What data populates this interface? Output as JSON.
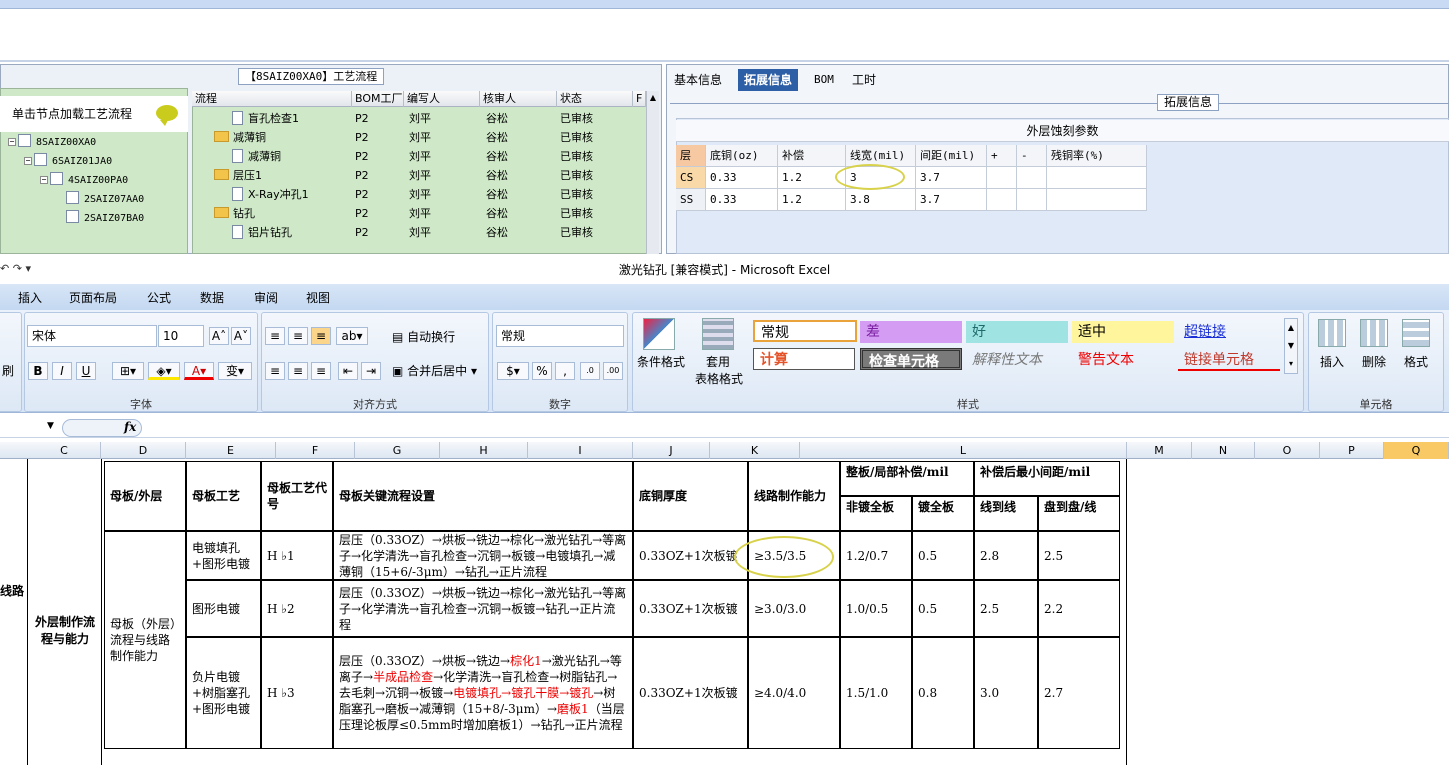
{
  "left_panel": {
    "title": "【8SAIZ00XA0】工艺流程",
    "tree_hint": "单击节点加载工艺流程",
    "tree": [
      {
        "label": "8SAIZ00XA0"
      },
      {
        "label": "6SAIZ01JA0"
      },
      {
        "label": "4SAIZ00PA0"
      },
      {
        "label": "2SAIZ07AA0"
      },
      {
        "label": "2SAIZ07BA0"
      }
    ],
    "grid_headers": [
      "流程",
      "BOM工厂",
      "编写人",
      "核审人",
      "状态",
      "F"
    ],
    "grid_rows": [
      {
        "flow": "盲孔检查1",
        "bom": "P2",
        "author": "刘平",
        "reviewer": "谷松",
        "status": "已审核",
        "folder": false
      },
      {
        "flow": "减薄铜",
        "bom": "P2",
        "author": "刘平",
        "reviewer": "谷松",
        "status": "已审核",
        "folder": true
      },
      {
        "flow": "减薄铜",
        "bom": "P2",
        "author": "刘平",
        "reviewer": "谷松",
        "status": "已审核",
        "folder": false
      },
      {
        "flow": "层压1",
        "bom": "P2",
        "author": "刘平",
        "reviewer": "谷松",
        "status": "已审核",
        "folder": true
      },
      {
        "flow": "X-Ray冲孔1",
        "bom": "P2",
        "author": "刘平",
        "reviewer": "谷松",
        "status": "已审核",
        "folder": false
      },
      {
        "flow": "钻孔",
        "bom": "P2",
        "author": "刘平",
        "reviewer": "谷松",
        "status": "已审核",
        "folder": true
      },
      {
        "flow": "铝片钻孔",
        "bom": "P2",
        "author": "刘平",
        "reviewer": "谷松",
        "status": "已审核",
        "folder": false
      }
    ]
  },
  "right_panel": {
    "tabs": [
      "基本信息",
      "拓展信息",
      "BOM",
      "工时"
    ],
    "legend": "拓展信息",
    "etch_title": "外层蚀刻参数",
    "etch_headers": [
      "层",
      "底铜(oz)",
      "补偿",
      "线宽(mil)",
      "间距(mil)",
      "+",
      "-",
      "残铜率(%)"
    ],
    "etch_rows": [
      [
        "CS",
        "0.33",
        "1.2",
        "3",
        "3.7",
        "",
        "",
        ""
      ],
      [
        "SS",
        "0.33",
        "1.2",
        "3.8",
        "3.7",
        "",
        "",
        ""
      ]
    ]
  },
  "excel": {
    "title": "激光钻孔  [兼容模式] - Microsoft Excel",
    "menus": [
      "插入",
      "页面布局",
      "公式",
      "数据",
      "审阅",
      "视图"
    ],
    "font_name": "宋体",
    "font_size": "10",
    "number_format": "常规",
    "wrap_text": "自动换行",
    "merge_center": "合并后居中",
    "cond_format": "条件格式",
    "table_format_1": "套用",
    "table_format_2": "表格格式",
    "styles": [
      "常规",
      "差",
      "好",
      "适中",
      "超链接",
      "计算",
      "检查单元格",
      "解释性文本",
      "警告文本",
      "链接单元格"
    ],
    "cells_buttons": [
      "插入",
      "删除",
      "格式"
    ],
    "group_labels": [
      "字体",
      "对齐方式",
      "数字",
      "样式",
      "单元格"
    ],
    "left_cut_label": "刷",
    "fx": "fx",
    "columns": [
      "C",
      "D",
      "E",
      "F",
      "G",
      "H",
      "I",
      "J",
      "K",
      "L",
      "M",
      "N",
      "O",
      "P",
      "Q"
    ]
  },
  "sheet": {
    "left_cut": "线路",
    "side_label": "外层制作流程与能力",
    "headers": {
      "mother_outer": "母板/外层",
      "mother_process": "母板工艺",
      "process_code": "母板工艺代号",
      "key_flow": "母板关键流程设置",
      "base_copper": "底铜厚度",
      "line_capability": "线路制作能力",
      "comp_group": "整板/局部补偿/mil",
      "comp_full": "非镀全板",
      "comp_plated": "镀全板",
      "spacing_group": "补偿后最小间距/mil",
      "line_to_line": "线到线",
      "pad_to_pad": "盘到盘/线"
    },
    "group_label": "母板（外层）流程与线路制作能力",
    "rows": [
      {
        "process": "电镀填孔+图形电镀",
        "code": "H ♭1",
        "flow_html": "层压（0.33OZ）→烘板→铣边→棕化→激光钻孔→等离子→化学清洗→盲孔检查→沉铜→板镀→电镀填孔→减薄铜（15+6/-3μm）→钻孔→正片流程",
        "copper": "0.33OZ+1次板镀",
        "capability": "≥3.5/3.5",
        "c1": "1.2/0.7",
        "c2": "0.5",
        "s1": "2.8",
        "s2": "2.5"
      },
      {
        "process": "图形电镀",
        "code": "H ♭2",
        "flow_html": "层压（0.33OZ）→烘板→铣边→棕化→激光钻孔→等离子→化学清洗→盲孔检查→沉铜→板镀→钻孔→正片流程",
        "copper": "0.33OZ+1次板镀",
        "capability": "≥3.0/3.0",
        "c1": "1.0/0.5",
        "c2": "0.5",
        "s1": "2.5",
        "s2": "2.2"
      },
      {
        "process": "负片电镀+树脂塞孔+图形电镀",
        "code": "H ♭3",
        "flow_html": "层压（0.33OZ）→烘板→铣边→<span class=\"red\">棕化1</span>→激光钻孔→等离子→<span class=\"red\">半成品检查</span>→化学清洗→盲孔检查→树脂钻孔→去毛刺→沉铜→板镀→<span class=\"red\">电镀填孔→镀孔干膜→镀孔</span>→树脂塞孔→磨板→减薄铜（15+8/-3μm）→<span class=\"red\">磨板1</span>（当层压理论板厚≤0.5mm时增加磨板1）→钻孔→正片流程",
        "copper": "0.33OZ+1次板镀",
        "capability": "≥4.0/4.0",
        "c1": "1.5/1.0",
        "c2": "0.8",
        "s1": "3.0",
        "s2": "2.7"
      }
    ]
  }
}
